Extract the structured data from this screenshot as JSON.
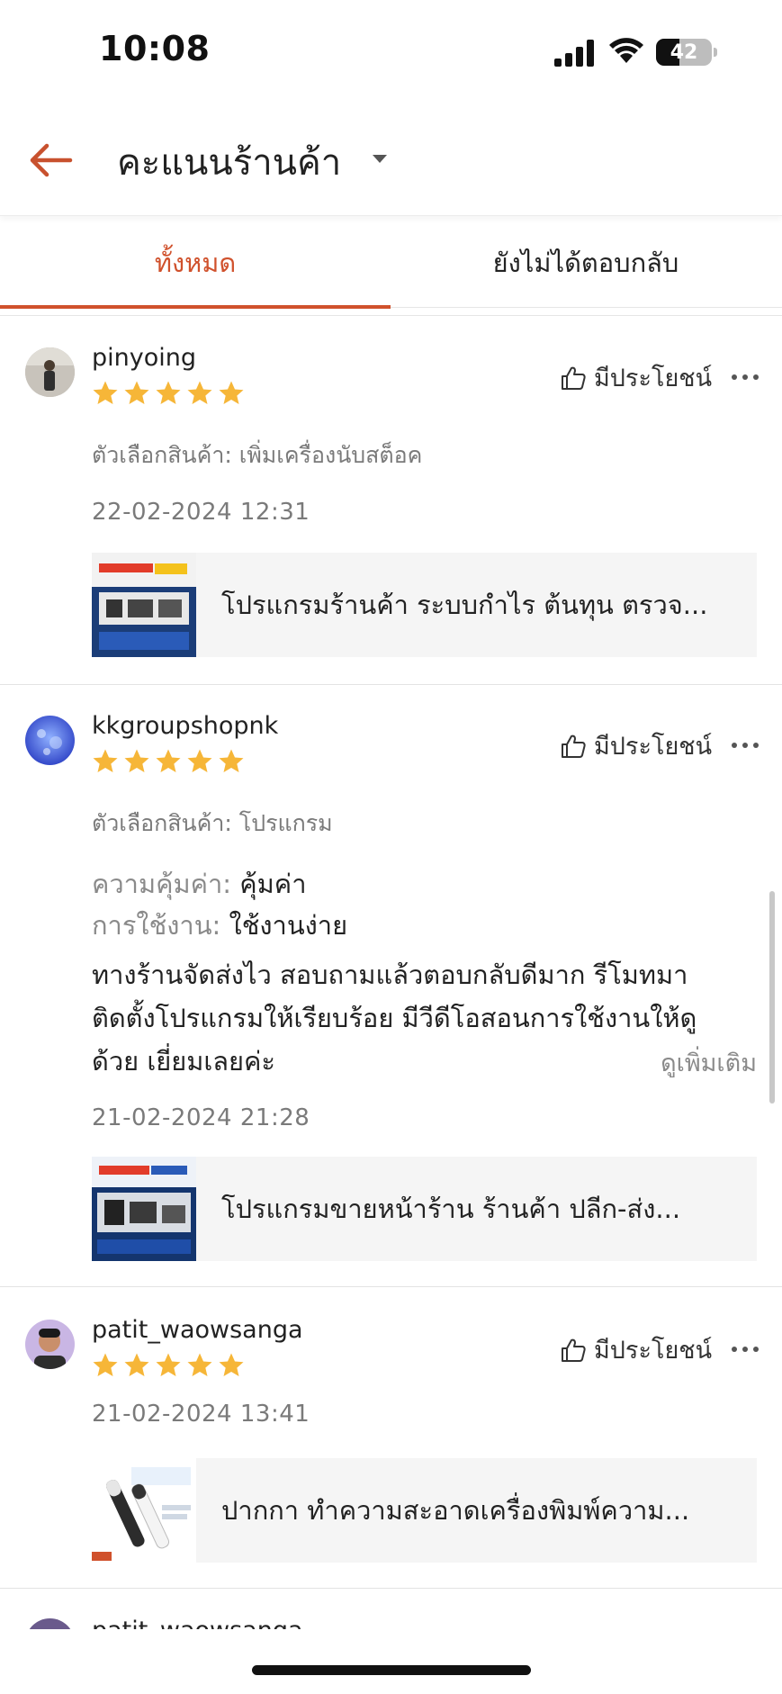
{
  "status_bar": {
    "time": "10:08",
    "battery_level": "42",
    "battery_fraction": 0.42
  },
  "header": {
    "title": "คะแนนร้านค้า"
  },
  "tabs": [
    {
      "label": "ทั้งหมด",
      "active": true
    },
    {
      "label": "ยังไม่ได้ตอบกลับ",
      "active": false
    }
  ],
  "reviews": [
    {
      "username": "pinyoing",
      "rating": 5,
      "helpful_label": "มีประโยชน์",
      "variation": "ตัวเลือกสินค้า: เพิ่มเครื่องนับสต็อค",
      "date": "22-02-2024 12:31",
      "product_name": "โปรแกรมร้านค้า ระบบกำไร ต้นทุน ตรวจ..."
    },
    {
      "username": "kkgroupshopnk",
      "rating": 5,
      "helpful_label": "มีประโยชน์",
      "variation": "ตัวเลือกสินค้า: โปรแกรม",
      "attributes": [
        {
          "key": "ความคุ้มค่า:",
          "value": "คุ้มค่า"
        },
        {
          "key": "การใช้งาน:",
          "value": "ใช้งานง่าย"
        }
      ],
      "body_lines": [
        "ทางร้านจัดส่งไว สอบถามแล้วตอบกลับดีมาก รีโมทมา",
        "ติดตั้งโปรแกรมให้เรียบร้อย มีวีดีโอสอนการใช้งานให้ดู",
        "ด้วย เยี่ยมเลยค่ะ"
      ],
      "see_more": "ดูเพิ่มเติม",
      "date": "21-02-2024 21:28",
      "product_name": "โปรแกรมขายหน้าร้าน ร้านค้า ปลีก-ส่ง..."
    },
    {
      "username": "patit_waowsanga",
      "rating": 5,
      "helpful_label": "มีประโยชน์",
      "date": "21-02-2024 13:41",
      "product_name": "ปากกา  ทำความสะอาดเครื่องพิมพ์ความ..."
    }
  ],
  "peek_username": "patit_waowsanga",
  "colors": {
    "accent": "#d0512c",
    "star": "#f6b638"
  },
  "icons": [
    "back-arrow-icon",
    "dropdown-caret-icon",
    "thumbs-up-icon",
    "more-options-icon",
    "star-icon",
    "signal-icon",
    "wifi-icon",
    "battery-icon"
  ]
}
